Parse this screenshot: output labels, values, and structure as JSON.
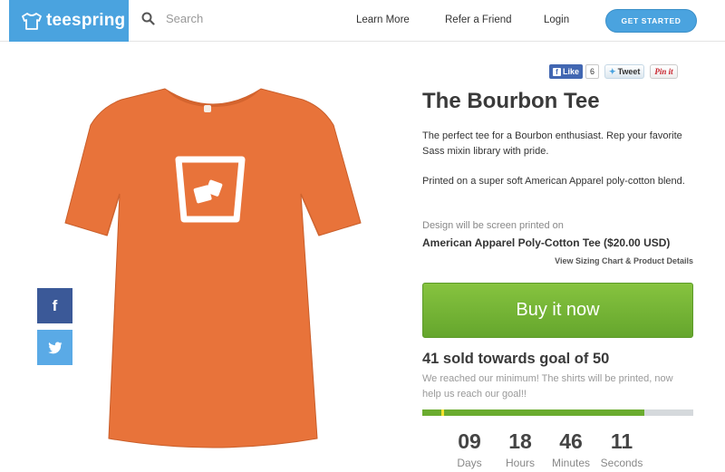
{
  "header": {
    "logo_text": "teespring",
    "search_placeholder": "Search",
    "nav": [
      "Learn More",
      "Refer a Friend",
      "Login"
    ],
    "cta_label": "GET STARTED"
  },
  "share": {
    "fb_like_label": "Like",
    "fb_count": "6",
    "tweet_label": "Tweet",
    "pin_label": "Pin it"
  },
  "product": {
    "title": "The Bourbon Tee",
    "description": "The perfect tee for a Bourbon enthusiast. Rep your favorite Sass mixin library with pride.",
    "fabric_note": "Printed on a super soft American Apparel poly-cotton blend.",
    "print_note": "Design will be screen printed on",
    "product_line": "American Apparel Poly-Cotton Tee ($20.00 USD)",
    "sizing_link": "View Sizing Chart & Product Details",
    "buy_label": "Buy it now",
    "shirt_color": "#e8733a",
    "primary_color": "#4aa3df",
    "buy_color": "#76b53a"
  },
  "campaign": {
    "goal_text": "41 sold towards goal of 50",
    "goal_note": "We reached our minimum! The shirts will be printed, now help us reach our goal!!",
    "sold": 41,
    "goal": 50,
    "minimum_fraction": 0.07
  },
  "countdown": [
    {
      "value": "09",
      "label": "Days"
    },
    {
      "value": "18",
      "label": "Hours"
    },
    {
      "value": "46",
      "label": "Minutes"
    },
    {
      "value": "11",
      "label": "Seconds"
    }
  ],
  "social": {
    "facebook_icon": "facebook-icon",
    "twitter_icon": "twitter-icon"
  }
}
